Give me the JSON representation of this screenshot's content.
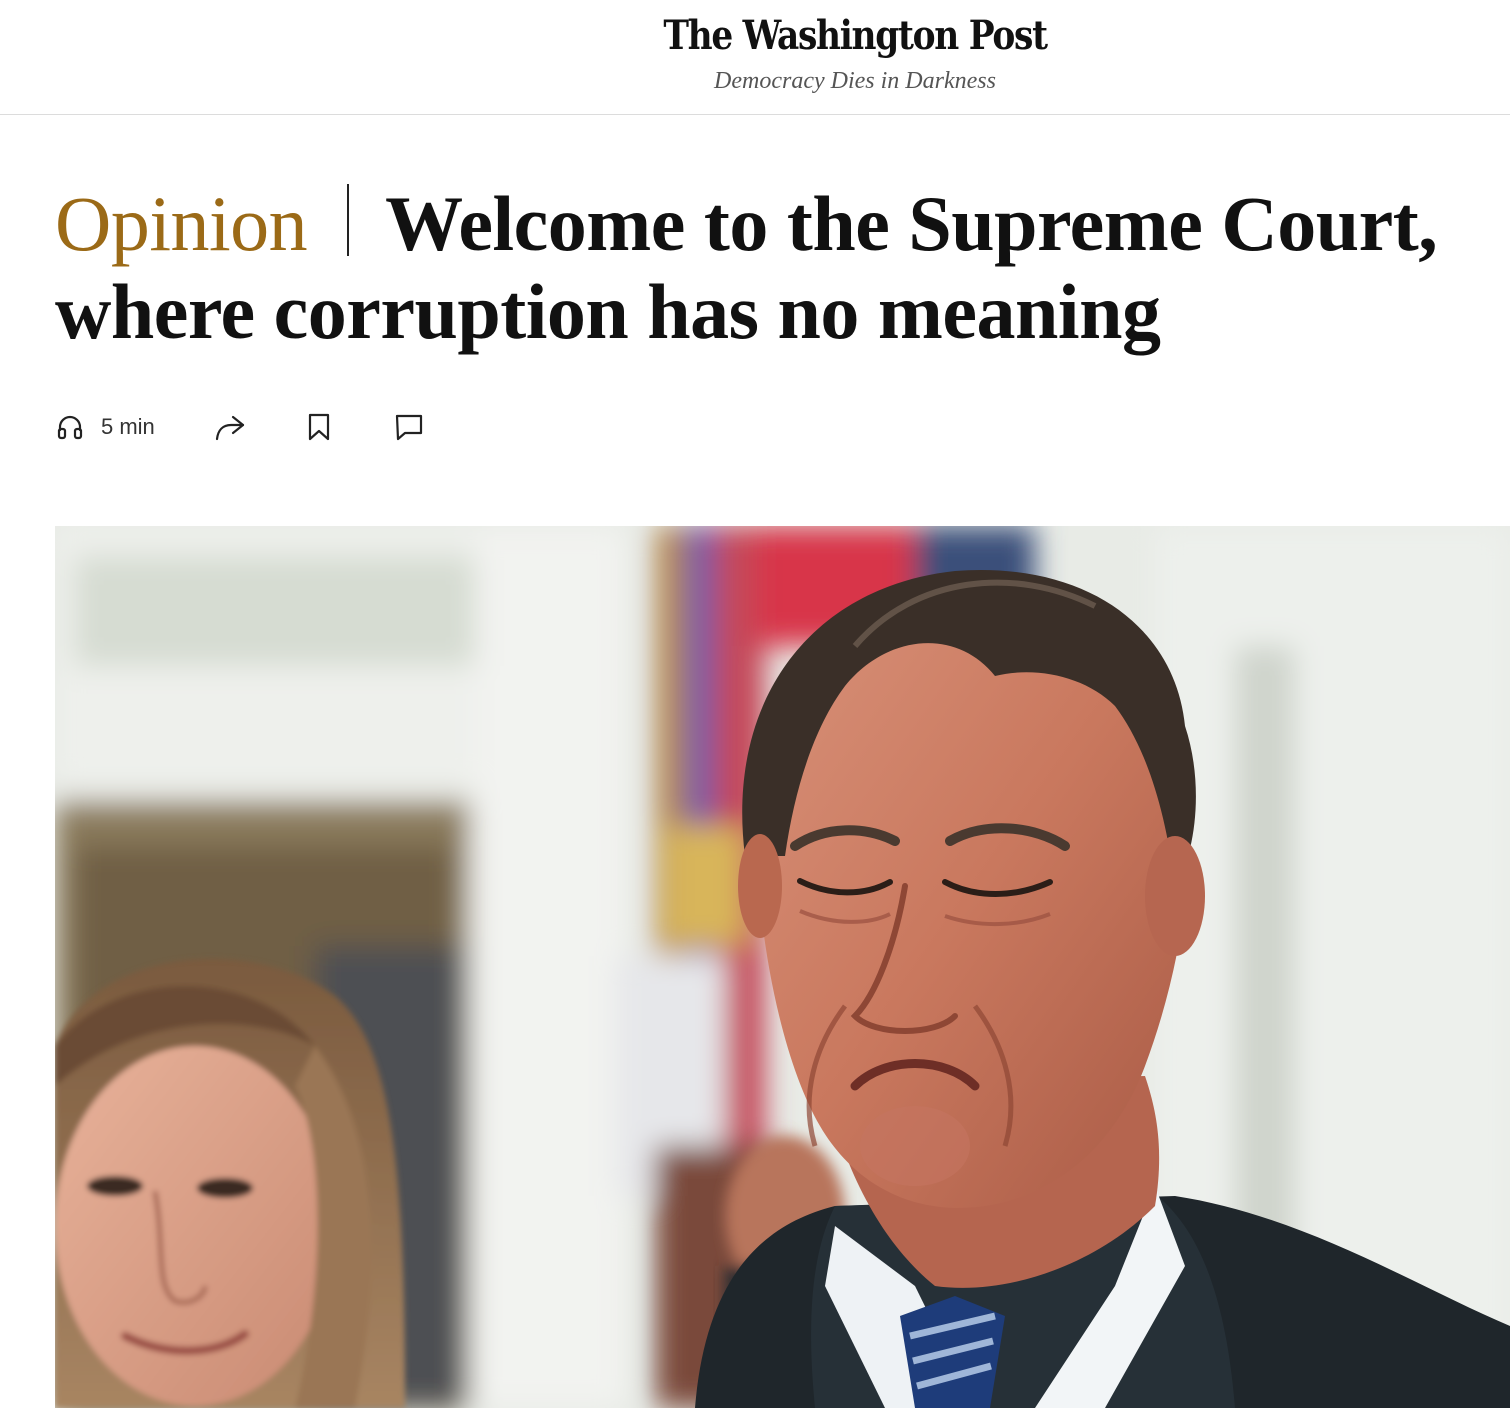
{
  "masthead": {
    "logo_text": "The Washington Post",
    "tagline": "Democracy Dies in Darkness"
  },
  "article": {
    "label": "Opinion",
    "title": "Welcome to the Supreme Court, where corruption has no meaning",
    "label_color": "#9b6a17"
  },
  "actions": {
    "listen_duration": "5 min",
    "icons": [
      "headphones-icon",
      "share-icon",
      "bookmark-icon",
      "comment-icon"
    ]
  }
}
